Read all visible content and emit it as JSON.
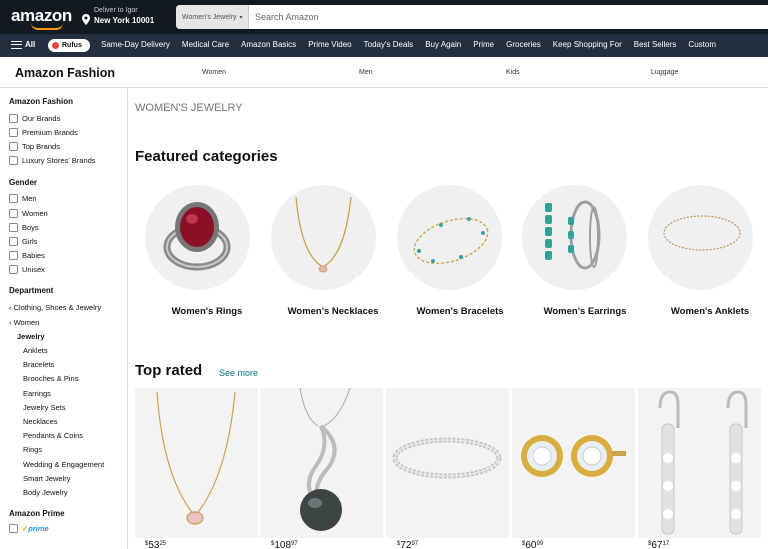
{
  "header": {
    "logo": "amazon",
    "deliver_line1": "Deliver to Igor",
    "deliver_line2": "New York 10001",
    "search_category": "Women's Jewelry",
    "search_placeholder": "Search Amazon"
  },
  "nav": {
    "all_label": "All",
    "rufus_label": "Rufus",
    "items": [
      "Same-Day Delivery",
      "Medical Care",
      "Amazon Basics",
      "Prime Video",
      "Today's Deals",
      "Buy Again",
      "Prime",
      "Groceries",
      "Keep Shopping For",
      "Best Sellers",
      "Custom"
    ]
  },
  "fashion_bar": {
    "title": "Amazon Fashion",
    "links": [
      "Women",
      "Men",
      "Kids",
      "Luggage"
    ]
  },
  "sidebar": {
    "amazon_fashion": {
      "heading": "Amazon Fashion",
      "options": [
        "Our Brands",
        "Premium Brands",
        "Top Brands",
        "Luxury Stores' Brands"
      ]
    },
    "gender": {
      "heading": "Gender",
      "options": [
        "Men",
        "Women",
        "Boys",
        "Girls",
        "Babies",
        "Unisex"
      ]
    },
    "department": {
      "heading": "Department",
      "back_links": [
        "Clothing, Shoes & Jewelry",
        "Women"
      ],
      "current": "Jewelry",
      "subcategories": [
        "Anklets",
        "Bracelets",
        "Brooches & Pins",
        "Earrings",
        "Jewelry Sets",
        "Necklaces",
        "Pendants & Coins",
        "Rings",
        "Wedding & Engagement",
        "Smart Jewelry",
        "Body Jewelry"
      ]
    },
    "amazon_prime": {
      "heading": "Amazon Prime",
      "option": "prime"
    }
  },
  "main": {
    "breadcrumb": "WOMEN'S JEWELRY",
    "featured_heading": "Featured categories",
    "categories": [
      "Women's Rings",
      "Women's Necklaces",
      "Women's Bracelets",
      "Women's Earrings",
      "Women's Anklets"
    ],
    "top_rated_heading": "Top rated",
    "see_more": "See more",
    "products": [
      {
        "currency": "$",
        "whole": "53",
        "fraction": "25"
      },
      {
        "currency": "$",
        "whole": "108",
        "fraction": "97"
      },
      {
        "currency": "$",
        "whole": "72",
        "fraction": "97"
      },
      {
        "currency": "$",
        "whole": "60",
        "fraction": "99"
      },
      {
        "currency": "$",
        "whole": "67",
        "fraction": "17"
      }
    ]
  },
  "colors": {
    "topbar": "#131921",
    "navbar": "#232f3e",
    "accent": "#ff9900",
    "link": "#007185"
  }
}
